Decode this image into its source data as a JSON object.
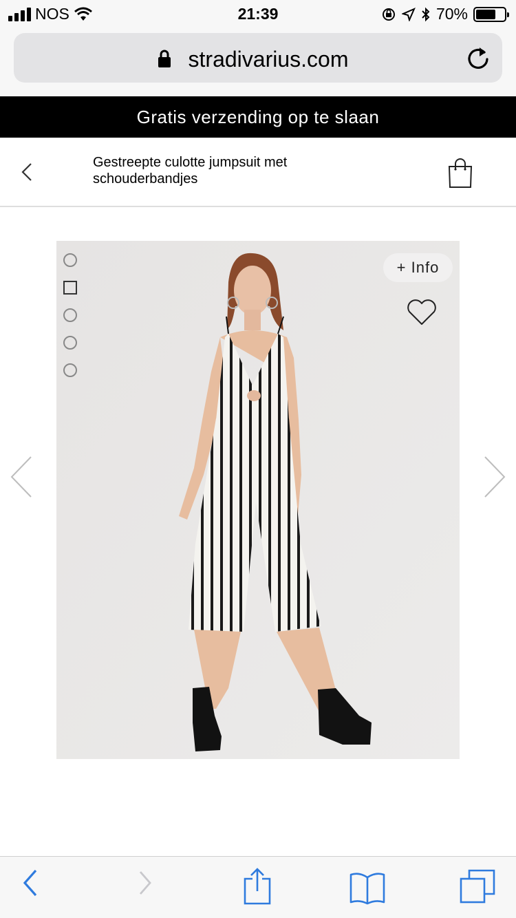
{
  "status_bar": {
    "carrier": "NOS",
    "time": "21:39",
    "battery_percent": "70%",
    "battery_level": 0.7
  },
  "browser": {
    "url": "stradivarius.com"
  },
  "promo": {
    "text": "Gratis verzending op te slaan"
  },
  "product": {
    "title": "Gestreepte culotte jumpsuit met schouderbandjes",
    "info_label": "+ Info",
    "image_count": 5,
    "active_image_index": 1
  },
  "colors": {
    "ios_blue": "#2f7bde",
    "banner_black": "#000000",
    "gallery_bg": "#e9e7e6"
  },
  "icons": [
    "signal-icon",
    "wifi-icon",
    "lock-icon",
    "reload-icon",
    "back-chevron-icon",
    "shopping-bag-icon",
    "heart-icon",
    "chevron-left-icon",
    "chevron-right-icon",
    "share-icon",
    "bookmarks-icon",
    "tabs-icon"
  ]
}
